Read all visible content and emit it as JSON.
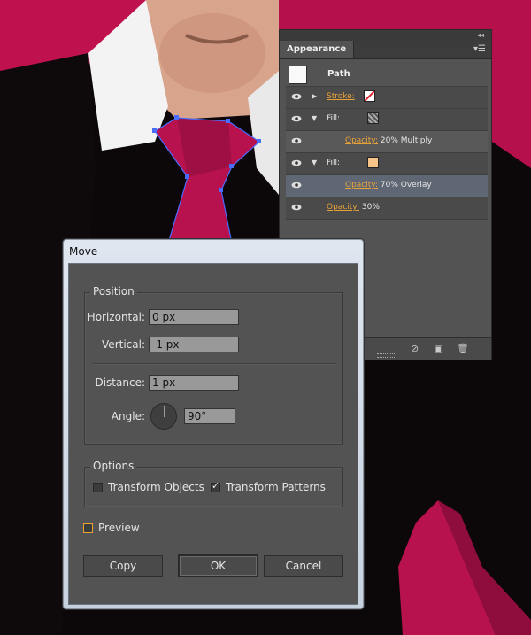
{
  "appearance_panel": {
    "tab_title": "Appearance",
    "object_label": "Path",
    "rows": [
      {
        "label": "Stroke:",
        "kind": "stroke"
      },
      {
        "label": "Fill:",
        "kind": "fill-pattern"
      },
      {
        "label": "Opacity:",
        "value": "20% Multiply",
        "kind": "opacity-nested"
      },
      {
        "label": "Fill:",
        "kind": "fill-color"
      },
      {
        "label": "Opacity:",
        "value": "70% Overlay",
        "kind": "opacity-nested-selected"
      },
      {
        "label": "Opacity:",
        "value": "30%",
        "kind": "opacity"
      }
    ],
    "fill_color": "#f7c48a"
  },
  "dialog": {
    "title": "Move",
    "position_group": "Position",
    "horizontal_label": "Horizontal:",
    "horizontal_value": "0 px",
    "vertical_label": "Vertical:",
    "vertical_value": "-1 px",
    "distance_label": "Distance:",
    "distance_value": "1 px",
    "angle_label": "Angle:",
    "angle_value": "90°",
    "options_group": "Options",
    "transform_objects_label": "Transform Objects",
    "transform_objects_checked": false,
    "transform_patterns_label": "Transform Patterns",
    "transform_patterns_checked": true,
    "preview_label": "Preview",
    "preview_checked": false,
    "copy_label": "Copy",
    "ok_label": "OK",
    "cancel_label": "Cancel"
  },
  "colors": {
    "accent_orange": "#e8a23a",
    "tie": "#b8124e",
    "background_magenta": "#c0114f"
  }
}
